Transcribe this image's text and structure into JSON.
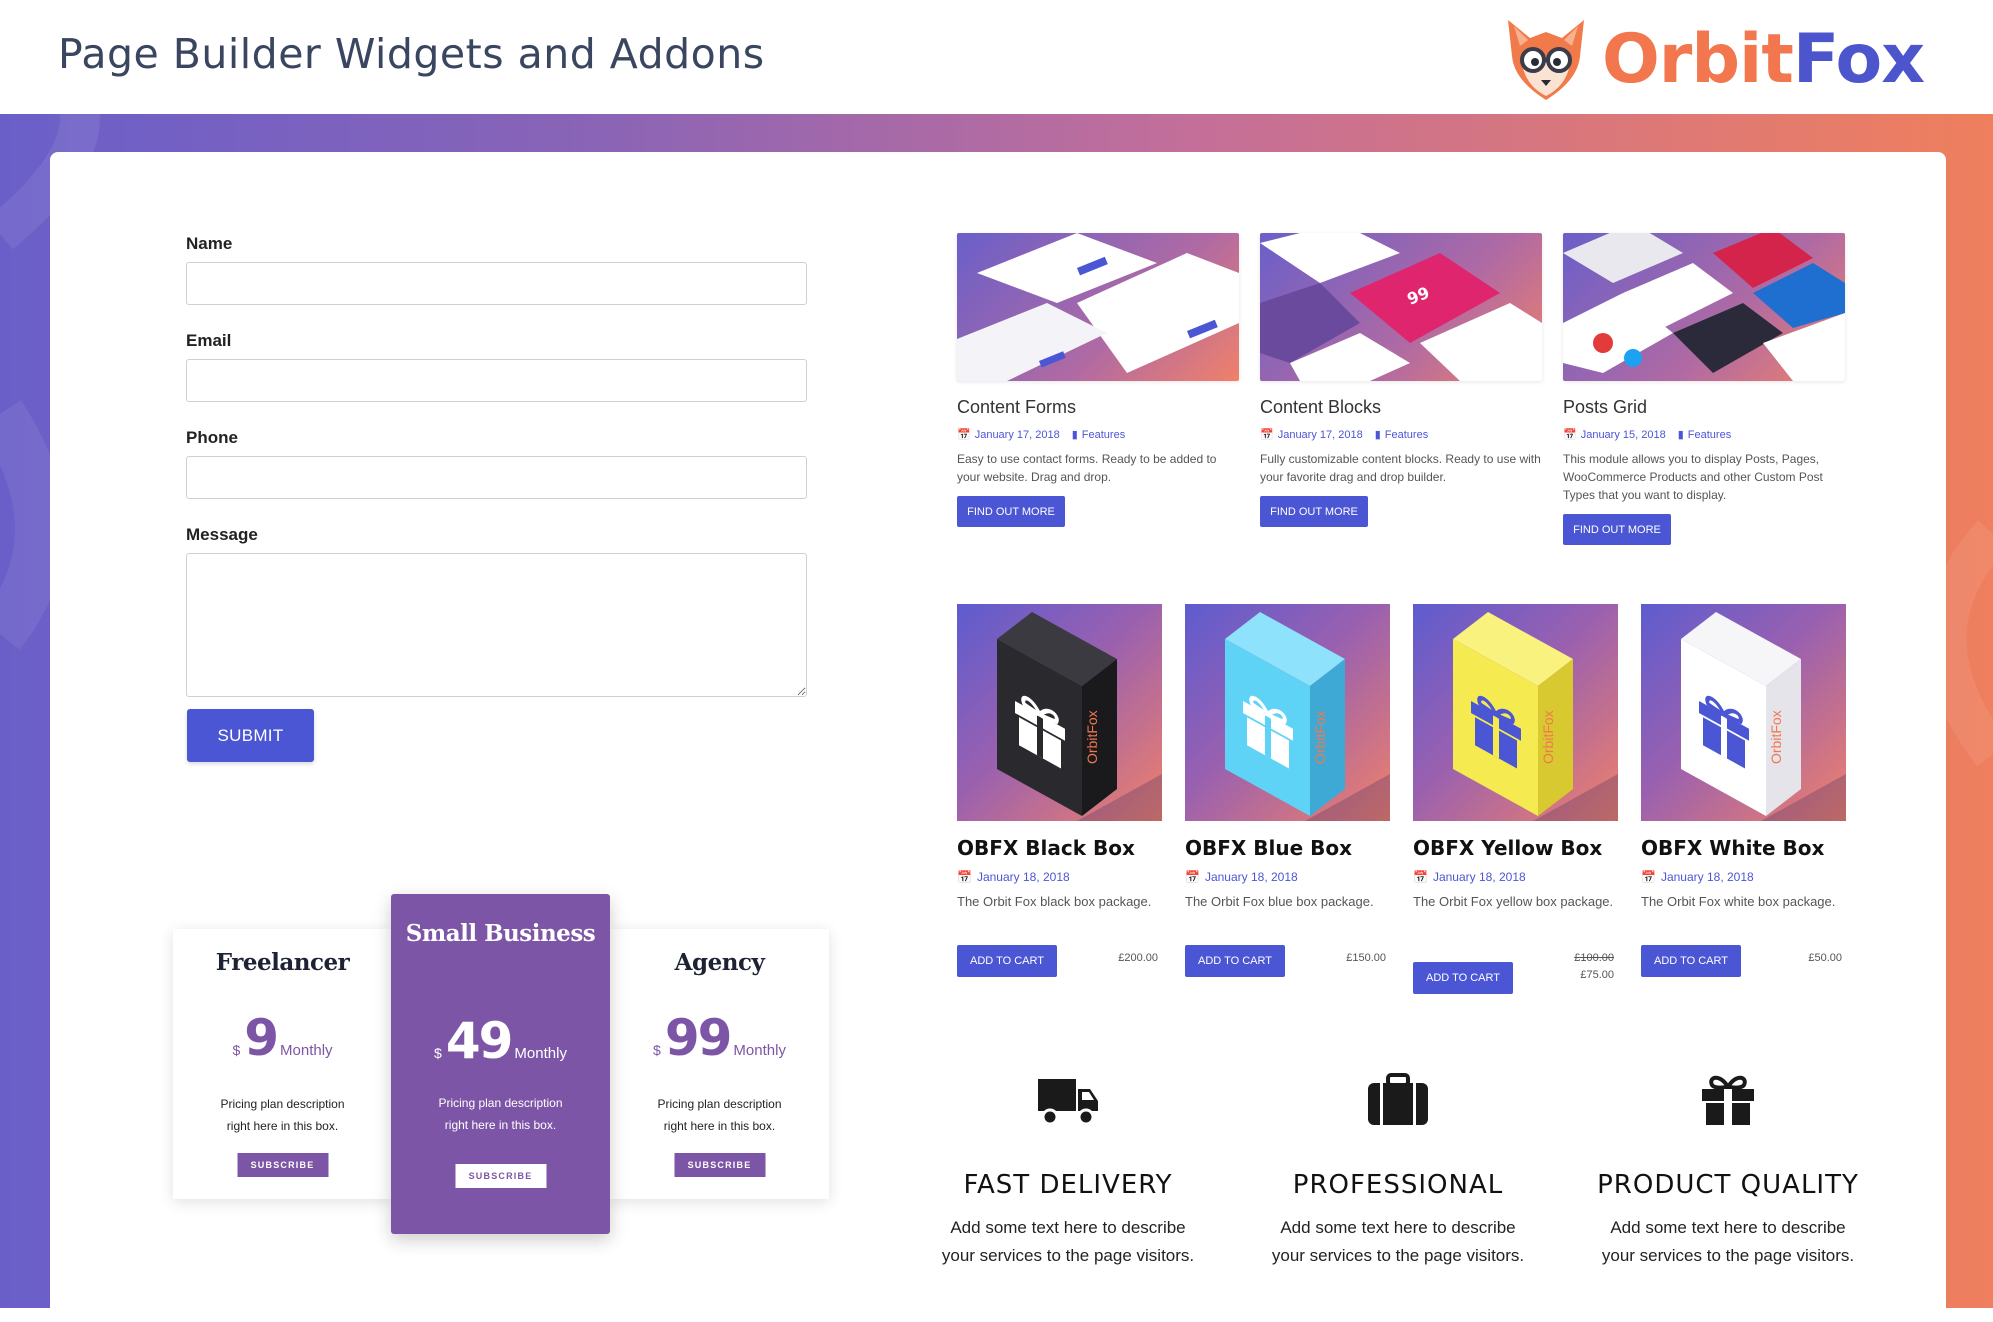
{
  "header": {
    "title": "Page Builder Widgets and Addons",
    "logo_text_1": "Orbit",
    "logo_text_2": "Fox"
  },
  "form": {
    "fields": [
      {
        "label": "Name",
        "value": "",
        "placeholder": ""
      },
      {
        "label": "Email",
        "value": "",
        "placeholder": ""
      },
      {
        "label": "Phone",
        "value": "",
        "placeholder": ""
      },
      {
        "label": "Message",
        "value": "",
        "placeholder": ""
      }
    ],
    "submit_label": "SUBMIT"
  },
  "pricing": {
    "plans": [
      {
        "name": "Freelancer",
        "currency": "$",
        "amount": "9",
        "period": "Monthly",
        "desc_1": "Pricing plan description",
        "desc_2": "right here in this box.",
        "button": "SUBSCRIBE"
      },
      {
        "name": "Small Business",
        "currency": "$",
        "amount": "49",
        "period": "Monthly",
        "desc_1": "Pricing plan description",
        "desc_2": "right here in this box.",
        "button": "SUBSCRIBE"
      },
      {
        "name": "Agency",
        "currency": "$",
        "amount": "99",
        "period": "Monthly",
        "desc_1": "Pricing plan description",
        "desc_2": "right here in this box.",
        "button": "SUBSCRIBE"
      }
    ]
  },
  "posts": [
    {
      "title": "Content Forms",
      "date": "January 17, 2018",
      "category": "Features",
      "excerpt": "Easy to use contact forms. Ready to be added to your website. Drag and drop.",
      "button": "FIND OUT MORE"
    },
    {
      "title": "Content Blocks",
      "date": "January 17, 2018",
      "category": "Features",
      "excerpt": "Fully customizable content blocks. Ready to use with your favorite drag and drop builder.",
      "button": "FIND OUT MORE"
    },
    {
      "title": "Posts Grid",
      "date": "January 15, 2018",
      "category": "Features",
      "excerpt": "This module allows you to display Posts, Pages, WooCommerce Products and other Custom Post Types that you want to display.",
      "button": "FIND OUT MORE"
    }
  ],
  "products": [
    {
      "name": "OBFX Black Box",
      "date": "January 18, 2018",
      "desc": "The Orbit Fox black box package.",
      "button": "ADD TO CART",
      "price": "£200.00",
      "old_price": "",
      "box_color": "#2a2a2e",
      "side_color": "#1a1a1d",
      "top_color": "#3a3a40",
      "gift_color": "#ffffff",
      "label_color": "#f2774f",
      "box_label": "OrbitFox"
    },
    {
      "name": "OBFX Blue Box",
      "date": "January 18, 2018",
      "desc": "The Orbit Fox blue box package.",
      "button": "ADD TO CART",
      "price": "£150.00",
      "old_price": "",
      "box_color": "#5fd3f5",
      "side_color": "#3fa9d6",
      "top_color": "#8fe2fb",
      "gift_color": "#ffffff",
      "label_color": "#f2774f",
      "box_label": "OrbitFox"
    },
    {
      "name": "OBFX Yellow Box",
      "date": "January 18, 2018",
      "desc": "The Orbit Fox yellow box package.",
      "button": "ADD TO CART",
      "price": "£75.00",
      "old_price": "£100.00",
      "box_color": "#f5ea4f",
      "side_color": "#d8c930",
      "top_color": "#faf27e",
      "gift_color": "#4b56d4",
      "label_color": "#f2774f",
      "box_label": "OrbitFox"
    },
    {
      "name": "OBFX White Box",
      "date": "January 18, 2018",
      "desc": "The Orbit Fox white box package.",
      "button": "ADD TO CART",
      "price": "£50.00",
      "old_price": "",
      "box_color": "#ffffff",
      "side_color": "#e4e4ea",
      "top_color": "#f6f6f8",
      "gift_color": "#4b56d4",
      "label_color": "#f2774f",
      "box_label": "OrbitFox"
    }
  ],
  "features": [
    {
      "title": "FAST DELIVERY",
      "desc_1": "Add some text here to describe",
      "desc_2": "your services to the page visitors.",
      "icon": "truck-icon"
    },
    {
      "title": "PROFESSIONAL",
      "desc_1": "Add some text here to describe",
      "desc_2": "your services to the page visitors.",
      "icon": "briefcase-icon"
    },
    {
      "title": "PRODUCT QUALITY",
      "desc_1": "Add some text here to describe",
      "desc_2": "your services to the page visitors.",
      "icon": "gift-icon"
    }
  ],
  "colors": {
    "accent": "#4b56d4",
    "plan_purple": "#7d55a6",
    "brand_orange": "#f2774f",
    "brand_blue": "#4d55cc"
  }
}
